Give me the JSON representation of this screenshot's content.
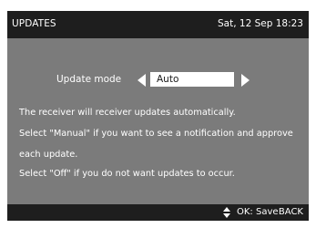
{
  "header": {
    "title": "UPDATES",
    "datetime": "Sat, 12 Sep 18:23"
  },
  "settings": {
    "update_mode_label": "Update mode",
    "update_mode_value": "Auto"
  },
  "description": [
    "The receiver will receiver updates automatically.",
    "Select \"Manual\" if you want to see a notification and approve",
    "each update.",
    "Select \"Off\" if you do not want updates to occur."
  ],
  "footer": {
    "nav_icon": "up-down-arrows-icon",
    "ok_label": "OK: Save",
    "back_label": "BACK"
  },
  "colors": {
    "header_bg": "#1e1e1e",
    "panel_bg": "#7b7b7b",
    "text": "#ffffff",
    "select_bg": "#ffffff"
  }
}
